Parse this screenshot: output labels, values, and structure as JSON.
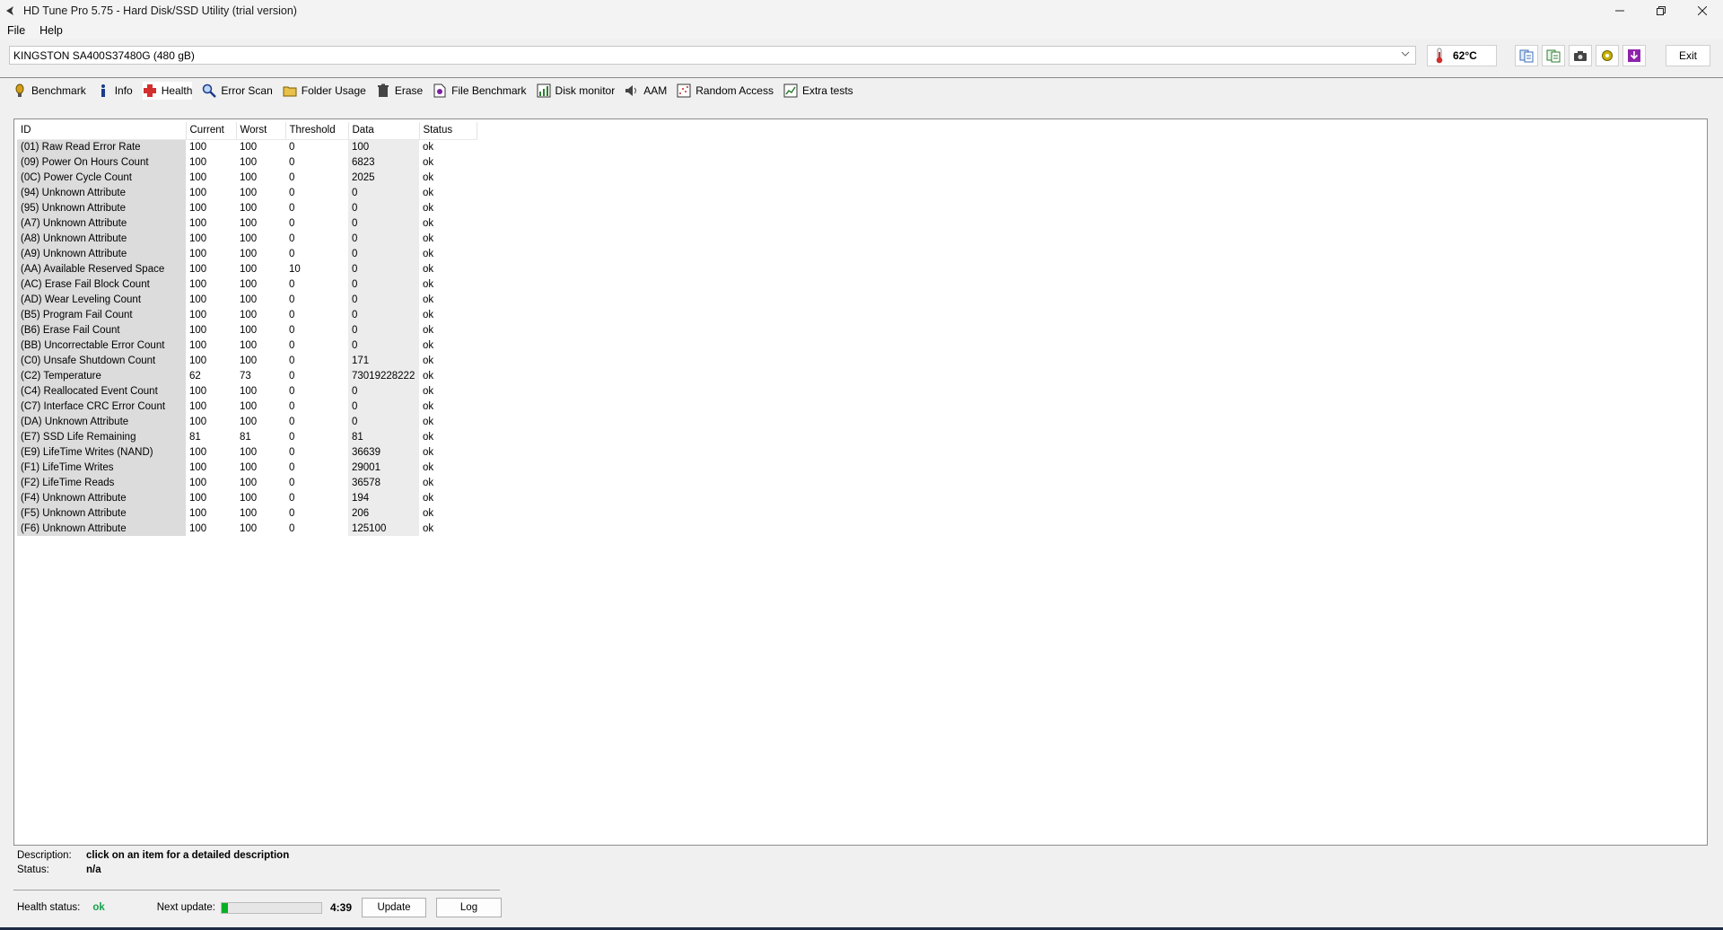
{
  "window": {
    "title": "HD Tune Pro 5.75 - Hard Disk/SSD Utility (trial version)",
    "app_icon": "hdtune-logo-icon",
    "controls": [
      "minimize-icon",
      "restore-icon",
      "close-icon"
    ]
  },
  "menu": [
    {
      "label": "File"
    },
    {
      "label": "Help"
    }
  ],
  "drive": {
    "selected": "KINGSTON SA400S37480G (480 gB)",
    "temperature": "62°C"
  },
  "toolbar": {
    "icons": [
      "copy-info-icon",
      "copy-text-icon",
      "screenshot-camera-icon",
      "options-gear-icon",
      "save-download-icon"
    ],
    "exit_label": "Exit"
  },
  "tabs": [
    {
      "label": "Benchmark",
      "icon": "benchmark-icon"
    },
    {
      "label": "Info",
      "icon": "info-icon"
    },
    {
      "label": "Health",
      "icon": "health-cross-icon",
      "active": true
    },
    {
      "label": "Error Scan",
      "icon": "error-scan-icon"
    },
    {
      "label": "Folder Usage",
      "icon": "folder-icon"
    },
    {
      "label": "Erase",
      "icon": "trash-icon"
    },
    {
      "label": "File Benchmark",
      "icon": "file-benchmark-icon"
    },
    {
      "label": "Disk monitor",
      "icon": "disk-monitor-icon"
    },
    {
      "label": "AAM",
      "icon": "speaker-icon"
    },
    {
      "label": "Random Access",
      "icon": "random-access-icon"
    },
    {
      "label": "Extra tests",
      "icon": "extra-tests-icon"
    }
  ],
  "health_table": {
    "columns": [
      "ID",
      "Current",
      "Worst",
      "Threshold",
      "Data",
      "Status"
    ],
    "rows": [
      [
        "(01) Raw Read Error Rate",
        "100",
        "100",
        "0",
        "100",
        "ok"
      ],
      [
        "(09) Power On Hours Count",
        "100",
        "100",
        "0",
        "6823",
        "ok"
      ],
      [
        "(0C) Power Cycle Count",
        "100",
        "100",
        "0",
        "2025",
        "ok"
      ],
      [
        "(94) Unknown Attribute",
        "100",
        "100",
        "0",
        "0",
        "ok"
      ],
      [
        "(95) Unknown Attribute",
        "100",
        "100",
        "0",
        "0",
        "ok"
      ],
      [
        "(A7) Unknown Attribute",
        "100",
        "100",
        "0",
        "0",
        "ok"
      ],
      [
        "(A8) Unknown Attribute",
        "100",
        "100",
        "0",
        "0",
        "ok"
      ],
      [
        "(A9) Unknown Attribute",
        "100",
        "100",
        "0",
        "0",
        "ok"
      ],
      [
        "(AA) Available Reserved Space",
        "100",
        "100",
        "10",
        "0",
        "ok"
      ],
      [
        "(AC) Erase Fail Block Count",
        "100",
        "100",
        "0",
        "0",
        "ok"
      ],
      [
        "(AD) Wear Leveling Count",
        "100",
        "100",
        "0",
        "0",
        "ok"
      ],
      [
        "(B5) Program Fail Count",
        "100",
        "100",
        "0",
        "0",
        "ok"
      ],
      [
        "(B6) Erase Fail Count",
        "100",
        "100",
        "0",
        "0",
        "ok"
      ],
      [
        "(BB) Uncorrectable Error Count",
        "100",
        "100",
        "0",
        "0",
        "ok"
      ],
      [
        "(C0) Unsafe Shutdown Count",
        "100",
        "100",
        "0",
        "171",
        "ok"
      ],
      [
        "(C2) Temperature",
        "62",
        "73",
        "0",
        "73019228222",
        "ok"
      ],
      [
        "(C4) Reallocated Event Count",
        "100",
        "100",
        "0",
        "0",
        "ok"
      ],
      [
        "(C7) Interface CRC Error Count",
        "100",
        "100",
        "0",
        "0",
        "ok"
      ],
      [
        "(DA) Unknown Attribute",
        "100",
        "100",
        "0",
        "0",
        "ok"
      ],
      [
        "(E7) SSD Life Remaining",
        "81",
        "81",
        "0",
        "81",
        "ok"
      ],
      [
        "(E9) LifeTime Writes (NAND)",
        "100",
        "100",
        "0",
        "36639",
        "ok"
      ],
      [
        "(F1) LifeTime Writes",
        "100",
        "100",
        "0",
        "29001",
        "ok"
      ],
      [
        "(F2) LifeTime Reads",
        "100",
        "100",
        "0",
        "36578",
        "ok"
      ],
      [
        "(F4) Unknown Attribute",
        "100",
        "100",
        "0",
        "194",
        "ok"
      ],
      [
        "(F5) Unknown Attribute",
        "100",
        "100",
        "0",
        "206",
        "ok"
      ],
      [
        "(F6) Unknown Attribute",
        "100",
        "100",
        "0",
        "125100",
        "ok"
      ]
    ]
  },
  "details": {
    "description_label": "Description:",
    "description_value": "click on an item for a detailed description",
    "status_label": "Status:",
    "status_value": "n/a"
  },
  "footer": {
    "health_status_label": "Health status:",
    "health_status_value": "ok",
    "health_status_color": "#16a34a",
    "next_update_label": "Next update:",
    "next_update_progress": 0.06,
    "countdown": "4:39",
    "update_label": "Update",
    "log_label": "Log"
  }
}
